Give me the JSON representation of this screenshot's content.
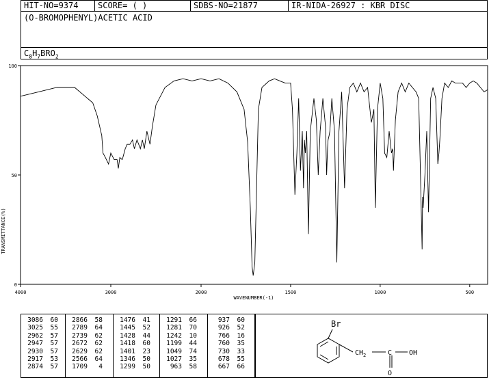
{
  "header": {
    "hit": "HIT-NO=9374",
    "score": "SCORE=  (   )",
    "sdbs": "SDBS-NO=21877",
    "ir": "IR-NIDA-26927 : KBR DISC"
  },
  "compound_name": "(O-BROMOPHENYL)ACETIC ACID",
  "formula": {
    "c": "C",
    "c_n": "8",
    "h": "H",
    "h_n": "7",
    "rest": "BRO",
    "o_n": "2"
  },
  "structure": {
    "br": "Br",
    "ch2": "CH",
    "ch2_n": "2",
    "c": "C",
    "oh": "OH",
    "o": "O"
  },
  "peaks": [
    [
      [
        "3086",
        "60"
      ],
      [
        "3025",
        "55"
      ],
      [
        "2962",
        "57"
      ],
      [
        "2947",
        "57"
      ],
      [
        "2930",
        "57"
      ],
      [
        "2917",
        "53"
      ],
      [
        "2874",
        "57"
      ]
    ],
    [
      [
        "2866",
        "58"
      ],
      [
        "2789",
        "64"
      ],
      [
        "2739",
        "62"
      ],
      [
        "2672",
        "62"
      ],
      [
        "2629",
        "62"
      ],
      [
        "2566",
        "64"
      ],
      [
        "1709",
        "4"
      ]
    ],
    [
      [
        "1476",
        "41"
      ],
      [
        "1445",
        "52"
      ],
      [
        "1428",
        "44"
      ],
      [
        "1418",
        "60"
      ],
      [
        "1401",
        "23"
      ],
      [
        "1346",
        "50"
      ],
      [
        "1299",
        "50"
      ]
    ],
    [
      [
        "1291",
        "66"
      ],
      [
        "1281",
        "70"
      ],
      [
        "1242",
        "10"
      ],
      [
        "1199",
        "44"
      ],
      [
        "1049",
        "74"
      ],
      [
        "1027",
        "35"
      ],
      [
        "963",
        "58"
      ]
    ],
    [
      [
        "937",
        "60"
      ],
      [
        "926",
        "52"
      ],
      [
        "766",
        "16"
      ],
      [
        "760",
        "35"
      ],
      [
        "730",
        "33"
      ],
      [
        "678",
        "55"
      ],
      [
        "667",
        "66"
      ]
    ]
  ],
  "chart_data": {
    "type": "line",
    "xlabel": "WAVENUMBER(-1)",
    "ylabel": "TRANSMITTANCE(%)",
    "xlim": [
      4000,
      400
    ],
    "ylim": [
      0,
      100
    ],
    "xticks": [
      4000,
      3000,
      2000,
      1500,
      1000,
      500
    ],
    "yticks": [
      0,
      50,
      100
    ],
    "x": [
      4000,
      3800,
      3600,
      3400,
      3200,
      3150,
      3100,
      3086,
      3060,
      3025,
      3000,
      2962,
      2947,
      2930,
      2917,
      2900,
      2874,
      2866,
      2840,
      2820,
      2789,
      2760,
      2739,
      2710,
      2672,
      2650,
      2629,
      2600,
      2566,
      2540,
      2500,
      2400,
      2300,
      2200,
      2100,
      2000,
      1950,
      1900,
      1850,
      1800,
      1760,
      1740,
      1725,
      1715,
      1709,
      1700,
      1690,
      1680,
      1660,
      1620,
      1590,
      1560,
      1530,
      1500,
      1490,
      1476,
      1465,
      1455,
      1445,
      1435,
      1428,
      1423,
      1418,
      1410,
      1401,
      1390,
      1370,
      1356,
      1346,
      1335,
      1320,
      1305,
      1299,
      1294,
      1291,
      1285,
      1281,
      1270,
      1255,
      1242,
      1230,
      1215,
      1199,
      1185,
      1170,
      1150,
      1130,
      1110,
      1090,
      1070,
      1049,
      1035,
      1027,
      1015,
      1000,
      985,
      975,
      963,
      950,
      937,
      930,
      926,
      915,
      900,
      880,
      860,
      840,
      820,
      800,
      785,
      775,
      766,
      763,
      760,
      750,
      740,
      730,
      718,
      705,
      690,
      678,
      672,
      667,
      655,
      640,
      620,
      600,
      580,
      560,
      540,
      520,
      500,
      480,
      460,
      440,
      420,
      400
    ],
    "y": [
      86,
      88,
      90,
      90,
      83,
      77,
      68,
      60,
      58,
      55,
      60,
      57,
      57,
      57,
      53,
      58,
      57,
      58,
      62,
      64,
      64,
      66,
      62,
      66,
      62,
      66,
      62,
      70,
      64,
      72,
      82,
      90,
      93,
      94,
      93,
      94,
      93,
      94,
      92,
      88,
      80,
      65,
      35,
      8,
      4,
      10,
      45,
      80,
      90,
      93,
      94,
      93,
      92,
      92,
      80,
      41,
      60,
      85,
      52,
      70,
      44,
      66,
      60,
      70,
      23,
      70,
      85,
      75,
      50,
      70,
      85,
      72,
      50,
      62,
      66,
      68,
      70,
      85,
      70,
      10,
      70,
      88,
      44,
      80,
      90,
      92,
      88,
      92,
      88,
      90,
      74,
      80,
      35,
      80,
      92,
      85,
      60,
      58,
      70,
      60,
      62,
      52,
      75,
      88,
      92,
      88,
      92,
      90,
      88,
      85,
      50,
      16,
      40,
      35,
      50,
      70,
      33,
      85,
      90,
      85,
      55,
      60,
      66,
      85,
      92,
      90,
      93,
      92,
      92,
      92,
      90,
      92,
      93,
      92,
      90,
      88,
      89
    ]
  }
}
